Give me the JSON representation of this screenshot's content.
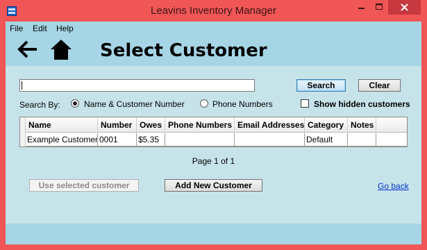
{
  "window": {
    "title": "Leavins Inventory Manager"
  },
  "menu": {
    "items": [
      "File",
      "Edit",
      "Help"
    ]
  },
  "header": {
    "back_icon": "back-arrow-icon",
    "home_icon": "home-icon",
    "title": "Select Customer"
  },
  "search": {
    "value": "",
    "search_label": "Search",
    "clear_label": "Clear",
    "search_by_label": "Search By:",
    "options": [
      "Name & Customer Number",
      "Phone Numbers"
    ],
    "selected_option": "Name & Customer Number",
    "show_hidden_label": "Show hidden customers",
    "show_hidden_checked": false
  },
  "grid": {
    "columns": [
      "Name",
      "Number",
      "Owes",
      "Phone Numbers",
      "Email Addresses",
      "Category",
      "Notes"
    ],
    "rows": [
      [
        "Example Customer",
        "0001",
        "$5.35",
        "",
        "",
        "Default",
        ""
      ]
    ]
  },
  "pager": {
    "text": "Page 1 of 1"
  },
  "actions": {
    "use_selected_label": "Use selected customer",
    "add_new_label": "Add New Customer",
    "go_back_label": "Go back"
  },
  "colors": {
    "window_frame": "#f15656",
    "close_button": "#c7383f",
    "header_band": "#a6d5e5",
    "content_bg": "#c7e3ea",
    "link": "#0033cc"
  }
}
